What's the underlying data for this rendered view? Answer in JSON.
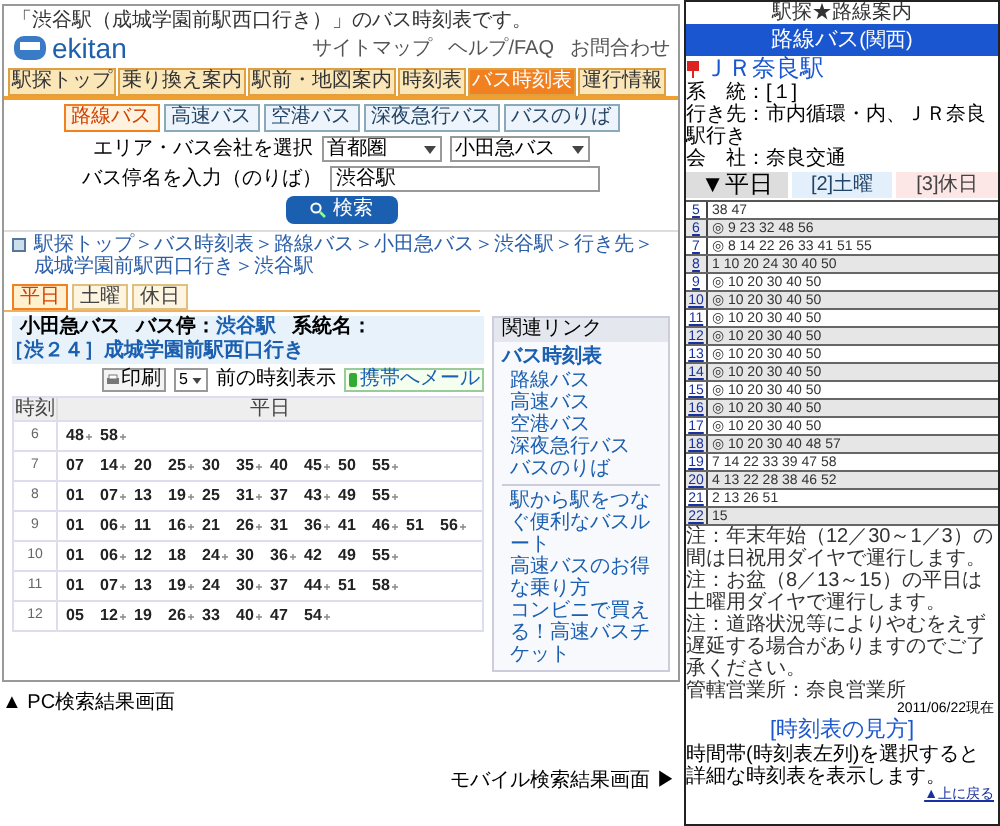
{
  "pc_screen": {
    "header_note": "「渋谷駅（成城学園前駅西口行き）」のバス時刻表です。",
    "header_links": [
      "サイトマップ",
      "ヘルプ/FAQ",
      "お問合わせ"
    ],
    "logo": "ekitan",
    "nav_tabs": [
      {
        "label": "駅探トップ",
        "selected": false
      },
      {
        "label": "乗り換え案内",
        "selected": false
      },
      {
        "label": "駅前・地図案内",
        "selected": false
      },
      {
        "label": "時刻表",
        "selected": false
      },
      {
        "label": "バス時刻表",
        "selected": true
      },
      {
        "label": "運行情報",
        "selected": false
      }
    ],
    "sub_tabs": [
      {
        "label": "路線バス",
        "selected": true
      },
      {
        "label": "高速バス",
        "selected": false
      },
      {
        "label": "空港バス",
        "selected": false
      },
      {
        "label": "深夜急行バス",
        "selected": false
      },
      {
        "label": "バスのりば",
        "selected": false
      }
    ],
    "form": {
      "area_label": "エリア・バス会社を選択",
      "area_value": "首都圏",
      "company_value": "小田急バス",
      "stop_label": "バス停名を入力（のりば）",
      "stop_value": "渋谷駅",
      "search_button": "検索"
    },
    "breadcrumb": "駅探トップ＞バス時刻表＞路線バス＞小田急バス＞渋谷駅＞行き先＞成城学園前駅西口行き＞渋谷駅",
    "day_tabs": [
      {
        "label": "平日",
        "selected": true
      },
      {
        "label": "土曜",
        "selected": false
      },
      {
        "label": "休日",
        "selected": false
      }
    ],
    "route": {
      "company": "小田急バス",
      "stop_label": "バス停：",
      "stop": "渋谷駅",
      "line_label": "系統名：",
      "line": "［渋２４］成城学園前駅西口行き"
    },
    "toolbar": {
      "print": "印刷",
      "count": "5",
      "count_label": "前の時刻表示",
      "mail": "携帯へメール"
    },
    "table": {
      "columns": [
        "時刻",
        "平日"
      ],
      "rows": [
        {
          "hour": "6",
          "times": [
            {
              "min": "48",
              "mark": true
            },
            {
              "min": "58",
              "mark": true
            }
          ]
        },
        {
          "hour": "7",
          "times": [
            {
              "min": "07",
              "mark": false
            },
            {
              "min": "14",
              "mark": true
            },
            {
              "min": "20",
              "mark": false
            },
            {
              "min": "25",
              "mark": true
            },
            {
              "min": "30",
              "mark": false
            },
            {
              "min": "35",
              "mark": true
            },
            {
              "min": "40",
              "mark": false
            },
            {
              "min": "45",
              "mark": true
            },
            {
              "min": "50",
              "mark": false
            },
            {
              "min": "55",
              "mark": true
            }
          ]
        },
        {
          "hour": "8",
          "times": [
            {
              "min": "01",
              "mark": false
            },
            {
              "min": "07",
              "mark": true
            },
            {
              "min": "13",
              "mark": false
            },
            {
              "min": "19",
              "mark": true
            },
            {
              "min": "25",
              "mark": false
            },
            {
              "min": "31",
              "mark": true
            },
            {
              "min": "37",
              "mark": false
            },
            {
              "min": "43",
              "mark": true
            },
            {
              "min": "49",
              "mark": false
            },
            {
              "min": "55",
              "mark": true
            }
          ]
        },
        {
          "hour": "9",
          "times": [
            {
              "min": "01",
              "mark": false
            },
            {
              "min": "06",
              "mark": true
            },
            {
              "min": "11",
              "mark": false
            },
            {
              "min": "16",
              "mark": true
            },
            {
              "min": "21",
              "mark": false
            },
            {
              "min": "26",
              "mark": true
            },
            {
              "min": "31",
              "mark": false
            },
            {
              "min": "36",
              "mark": true
            },
            {
              "min": "41",
              "mark": false
            },
            {
              "min": "46",
              "mark": true
            },
            {
              "min": "51",
              "mark": false
            },
            {
              "min": "56",
              "mark": true
            }
          ]
        },
        {
          "hour": "10",
          "times": [
            {
              "min": "01",
              "mark": false
            },
            {
              "min": "06",
              "mark": true
            },
            {
              "min": "12",
              "mark": false
            },
            {
              "min": "18",
              "mark": false
            },
            {
              "min": "24",
              "mark": true
            },
            {
              "min": "30",
              "mark": false
            },
            {
              "min": "36",
              "mark": true
            },
            {
              "min": "42",
              "mark": false
            },
            {
              "min": "49",
              "mark": false
            },
            {
              "min": "55",
              "mark": true
            }
          ]
        },
        {
          "hour": "11",
          "times": [
            {
              "min": "01",
              "mark": false
            },
            {
              "min": "07",
              "mark": true
            },
            {
              "min": "13",
              "mark": false
            },
            {
              "min": "19",
              "mark": true
            },
            {
              "min": "24",
              "mark": false
            },
            {
              "min": "30",
              "mark": true
            },
            {
              "min": "37",
              "mark": false
            },
            {
              "min": "44",
              "mark": true
            },
            {
              "min": "51",
              "mark": false
            },
            {
              "min": "58",
              "mark": true
            }
          ]
        },
        {
          "hour": "12",
          "times": [
            {
              "min": "05",
              "mark": false
            },
            {
              "min": "12",
              "mark": true
            },
            {
              "min": "19",
              "mark": false
            },
            {
              "min": "26",
              "mark": true
            },
            {
              "min": "33",
              "mark": false
            },
            {
              "min": "40",
              "mark": true
            },
            {
              "min": "47",
              "mark": false
            },
            {
              "min": "54",
              "mark": true
            }
          ]
        }
      ]
    },
    "sidebar": {
      "title": "関連リンク",
      "group": "バス時刻表",
      "items": [
        "路線バス",
        "高速バス",
        "空港バス",
        "深夜急行バス",
        "バスのりば"
      ],
      "links": [
        "駅から駅をつなぐ便利なバスルート",
        "高速バスのお得な乗り方",
        "コンビニで買える！高速バスチケット"
      ]
    }
  },
  "pc_caption": "▲ PC検索結果画面",
  "mobile_caption": "モバイル検索結果画面 ▶",
  "mobile_screen": {
    "header": "駅探★路線案内",
    "title": "路線バス",
    "region": "(関西)",
    "stop": "ＪＲ奈良駅",
    "info": [
      "系　統：[１]",
      "行き先：市内循環・内、ＪＲ奈良駅行き",
      "会　社：奈良交通"
    ],
    "day_tabs": [
      {
        "label": "▼平日",
        "selected": true
      },
      {
        "label": "[2]土曜",
        "selected": false
      },
      {
        "label": "[3]休日",
        "selected": false
      }
    ],
    "rows": [
      {
        "hour": "5",
        "minutes": "38 47"
      },
      {
        "hour": "6",
        "minutes": "◎ 9 23 32 48 56"
      },
      {
        "hour": "7",
        "minutes": "◎ 8 14 22 26 33 41 51 55"
      },
      {
        "hour": "8",
        "minutes": "1 10 20 24 30 40 50"
      },
      {
        "hour": "9",
        "minutes": "◎ 10 20 30 40 50"
      },
      {
        "hour": "10",
        "minutes": "◎ 10 20 30 40 50"
      },
      {
        "hour": "11",
        "minutes": "◎ 10 20 30 40 50"
      },
      {
        "hour": "12",
        "minutes": "◎ 10 20 30 40 50"
      },
      {
        "hour": "13",
        "minutes": "◎ 10 20 30 40 50"
      },
      {
        "hour": "14",
        "minutes": "◎ 10 20 30 40 50"
      },
      {
        "hour": "15",
        "minutes": "◎ 10 20 30 40 50"
      },
      {
        "hour": "16",
        "minutes": "◎ 10 20 30 40 50"
      },
      {
        "hour": "17",
        "minutes": "◎ 10 20 30 40 50"
      },
      {
        "hour": "18",
        "minutes": "◎ 10 20 30 40 48 57"
      },
      {
        "hour": "19",
        "minutes": "7 14 22 33 39 47 58"
      },
      {
        "hour": "20",
        "minutes": "4 13 22 28 38 46 52"
      },
      {
        "hour": "21",
        "minutes": "2 13 26 51"
      },
      {
        "hour": "22",
        "minutes": "15"
      }
    ],
    "notes": [
      "注：年末年始（12／30～1／3）の間は日祝用ダイヤで運行します。",
      "注：お盆（8／13～15）の平日は土曜用ダイヤで運行します。",
      "注：道路状況等によりやむをえず遅延する場合がありますのでご了承ください。",
      "管轄営業所：奈良営業所"
    ],
    "date": "2011/06/22現在",
    "help_link": "[時刻表の見方]",
    "help_text": "時間帯(時刻表左列)を選択すると詳細な時刻表を表示します。",
    "back_link": "▲上に戻る"
  }
}
